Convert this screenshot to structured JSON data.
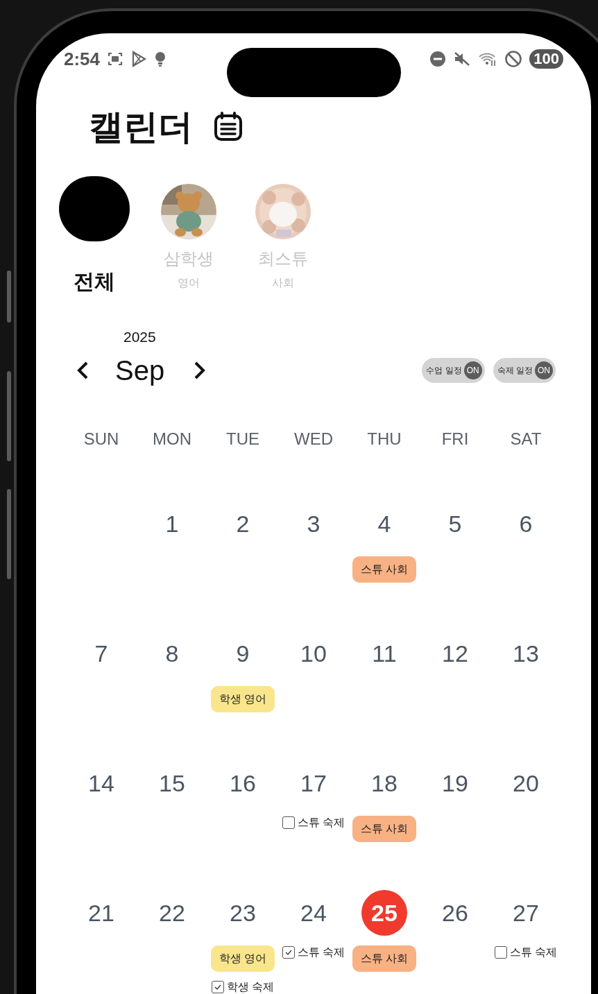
{
  "status_bar": {
    "time": "2:54",
    "battery": "100"
  },
  "title": "캘린더",
  "profiles": [
    {
      "kind": "all",
      "name": "전체",
      "selected": true
    },
    {
      "kind": "student",
      "name": "삼학생",
      "subject": "영어",
      "selected": false
    },
    {
      "kind": "student",
      "name": "최스튜",
      "subject": "사회",
      "selected": false
    }
  ],
  "year": "2025",
  "month": "Sep",
  "toggles": [
    {
      "label": "수업 일정",
      "state": "ON",
      "on": true
    },
    {
      "label": "숙제 일정",
      "state": "ON",
      "on": true
    }
  ],
  "weekdays": [
    "SUN",
    "MON",
    "TUE",
    "WED",
    "THU",
    "FRI",
    "SAT"
  ],
  "weeks": [
    [
      {
        "kind": "blank"
      },
      {
        "kind": "day",
        "day": "1",
        "today": false
      },
      {
        "kind": "day",
        "day": "2",
        "today": false
      },
      {
        "kind": "day",
        "day": "3",
        "today": false
      },
      {
        "kind": "day",
        "day": "4",
        "today": false,
        "events": [
          {
            "kind": "class",
            "label": "스튜 사회",
            "color": "#f8b183"
          }
        ]
      },
      {
        "kind": "day",
        "day": "5",
        "today": false
      },
      {
        "kind": "day",
        "day": "6",
        "today": false
      }
    ],
    [
      {
        "kind": "day",
        "day": "7",
        "today": false
      },
      {
        "kind": "day",
        "day": "8",
        "today": false
      },
      {
        "kind": "day",
        "day": "9",
        "today": false,
        "events": [
          {
            "kind": "class",
            "label": "학생 영어",
            "color": "#f9e68c"
          }
        ]
      },
      {
        "kind": "day",
        "day": "10",
        "today": false
      },
      {
        "kind": "day",
        "day": "11",
        "today": false
      },
      {
        "kind": "day",
        "day": "12",
        "today": false
      },
      {
        "kind": "day",
        "day": "13",
        "today": false
      }
    ],
    [
      {
        "kind": "day",
        "day": "14",
        "today": false
      },
      {
        "kind": "day",
        "day": "15",
        "today": false
      },
      {
        "kind": "day",
        "day": "16",
        "today": false
      },
      {
        "kind": "day",
        "day": "17",
        "today": false,
        "events": [
          {
            "kind": "homework",
            "label": "스튜 숙제",
            "checked": false
          }
        ]
      },
      {
        "kind": "day",
        "day": "18",
        "today": false,
        "events": [
          {
            "kind": "class",
            "label": "스튜 사회",
            "color": "#f8b183"
          }
        ]
      },
      {
        "kind": "day",
        "day": "19",
        "today": false
      },
      {
        "kind": "day",
        "day": "20",
        "today": false
      }
    ],
    [
      {
        "kind": "day",
        "day": "21",
        "today": false
      },
      {
        "kind": "day",
        "day": "22",
        "today": false
      },
      {
        "kind": "day",
        "day": "23",
        "today": false,
        "events": [
          {
            "kind": "class",
            "label": "학생 영어",
            "color": "#f9e68c"
          },
          {
            "kind": "homework",
            "label": "학생 숙제",
            "checked": true
          }
        ]
      },
      {
        "kind": "day",
        "day": "24",
        "today": false,
        "events": [
          {
            "kind": "homework",
            "label": "스튜 숙제",
            "checked": true
          }
        ]
      },
      {
        "kind": "day",
        "day": "25",
        "today": true,
        "events": [
          {
            "kind": "class",
            "label": "스튜 사회",
            "color": "#f8b183"
          }
        ]
      },
      {
        "kind": "day",
        "day": "26",
        "today": false
      },
      {
        "kind": "day",
        "day": "27",
        "today": false,
        "events": [
          {
            "kind": "homework",
            "label": "스튜 숙제",
            "checked": false
          }
        ]
      }
    ]
  ]
}
